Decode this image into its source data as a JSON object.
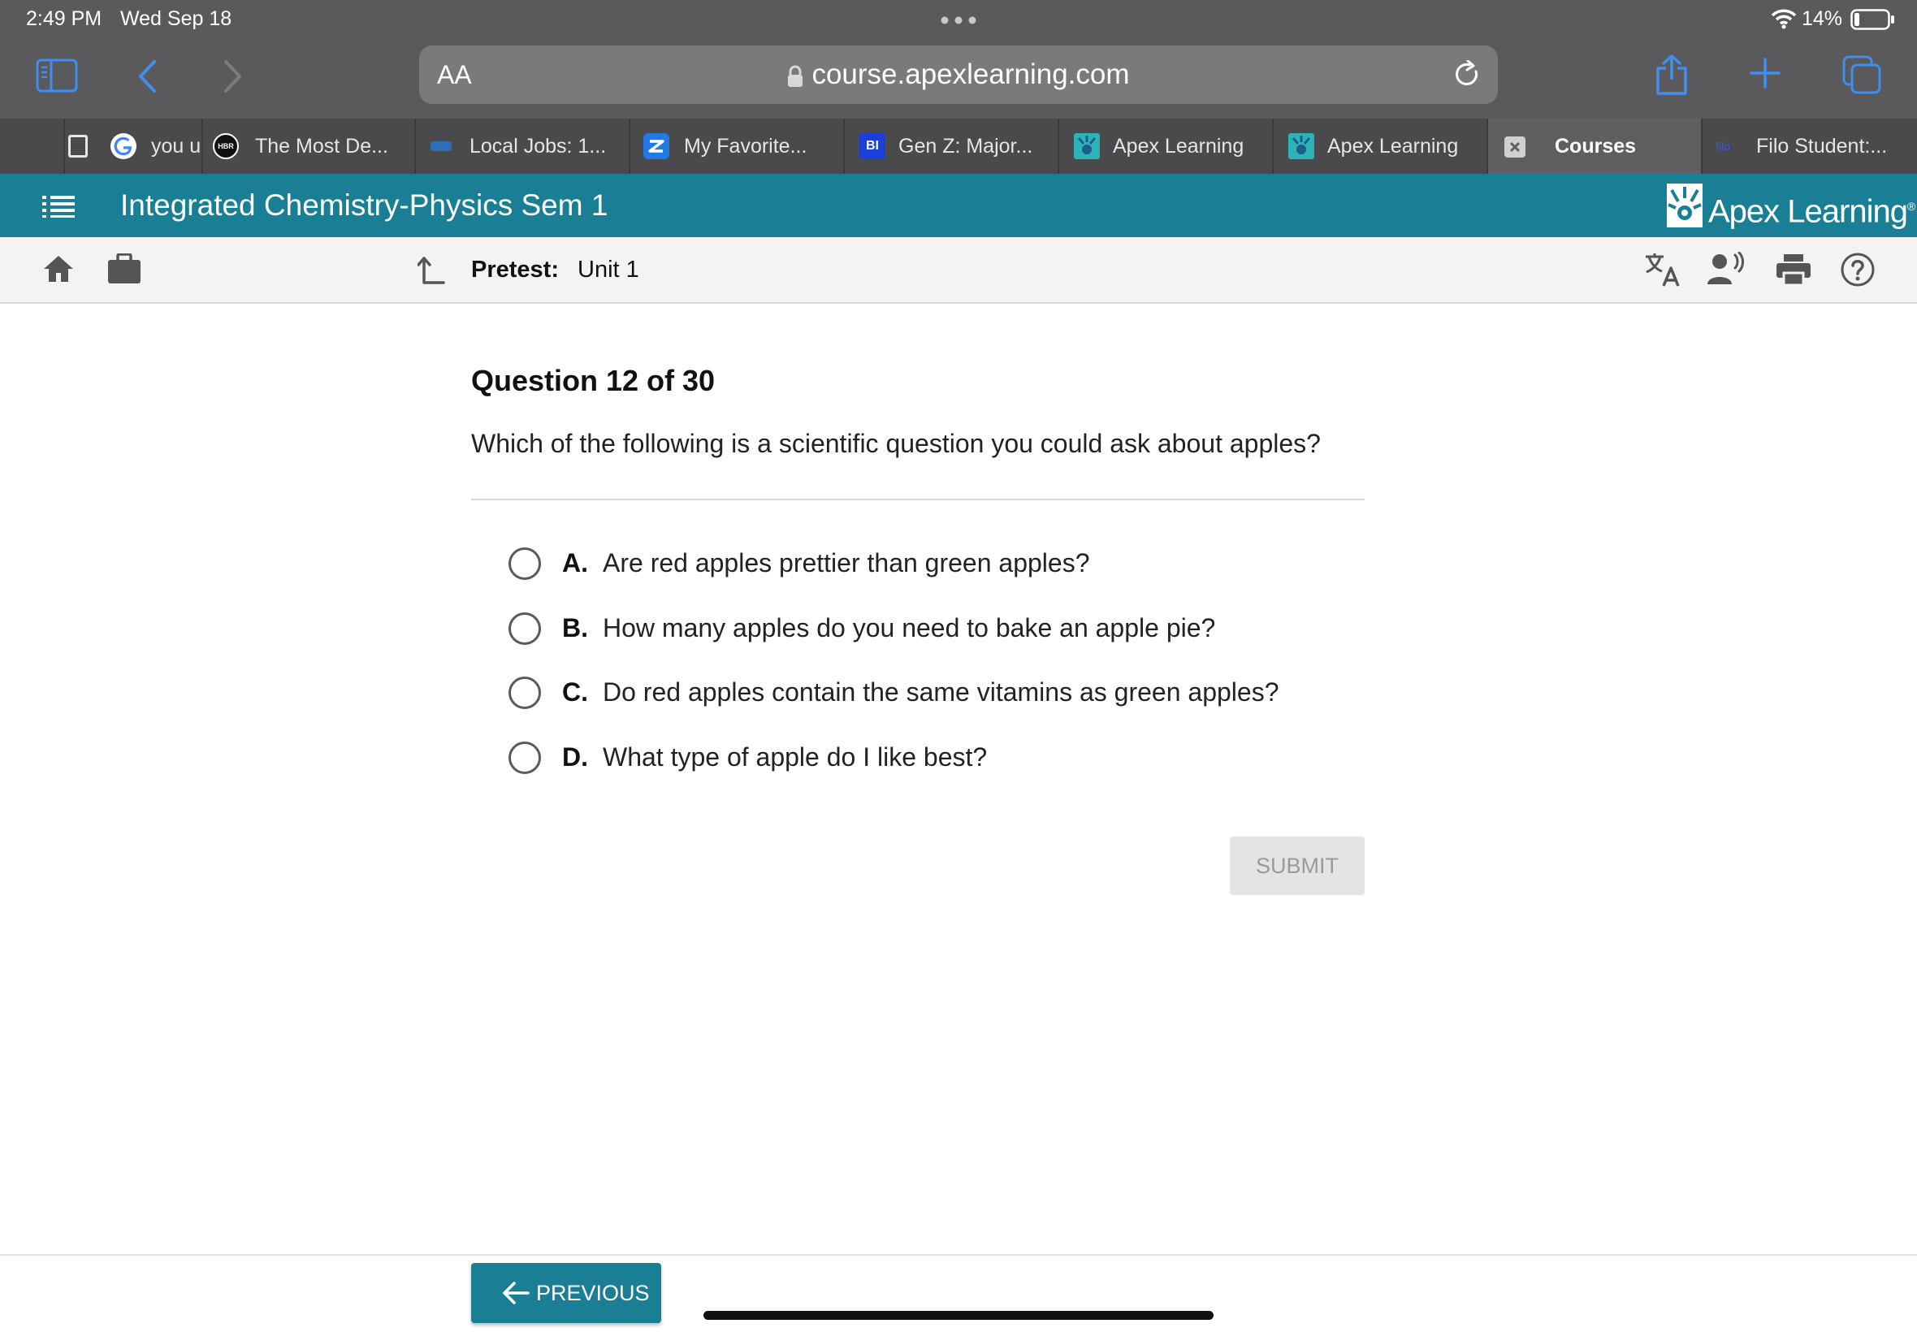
{
  "status_bar": {
    "time": "2:49 PM",
    "date": "Wed Sep 18",
    "battery": "14%"
  },
  "browser": {
    "text_size_label": "AA",
    "url": "course.apexlearning.com",
    "tabs": [
      {
        "label": "you u",
        "favicon": "google-icon"
      },
      {
        "label": "The Most De...",
        "favicon": "hbr-icon"
      },
      {
        "label": "Local Jobs: 1...",
        "favicon": "jobs-icon"
      },
      {
        "label": "My Favorite...",
        "favicon": "z-icon"
      },
      {
        "label": "Gen Z: Major...",
        "favicon": "bi-icon"
      },
      {
        "label": "Apex Learning",
        "favicon": "apex-icon"
      },
      {
        "label": "Apex Learning",
        "favicon": "apex-icon"
      },
      {
        "label": "Courses",
        "favicon": "close-icon"
      },
      {
        "label": "Filo Student:...",
        "favicon": "filo-icon"
      }
    ],
    "favicon_labels": {
      "hbr": "HBR",
      "bi": "BI",
      "filo": "filo"
    }
  },
  "app": {
    "course_title": "Integrated Chemistry-Physics Sem 1",
    "brand_name": "Apex Learning",
    "brand_mark": "®",
    "accent_color": "#1a7f94"
  },
  "toolbar": {
    "pretest_label": "Pretest:",
    "pretest_value": "Unit 1"
  },
  "question": {
    "heading": "Question 12 of 30",
    "prompt": "Which of the following is a scientific question you could ask about apples?",
    "options": [
      {
        "letter": "A.",
        "text": "Are red apples prettier than green apples?"
      },
      {
        "letter": "B.",
        "text": "How many apples do you need to bake an apple pie?"
      },
      {
        "letter": "C.",
        "text": "Do red apples contain the same vitamins as green apples?"
      },
      {
        "letter": "D.",
        "text": "What type of apple do I like best?"
      }
    ],
    "submit_label": "SUBMIT"
  },
  "footer": {
    "previous_label": "PREVIOUS"
  }
}
